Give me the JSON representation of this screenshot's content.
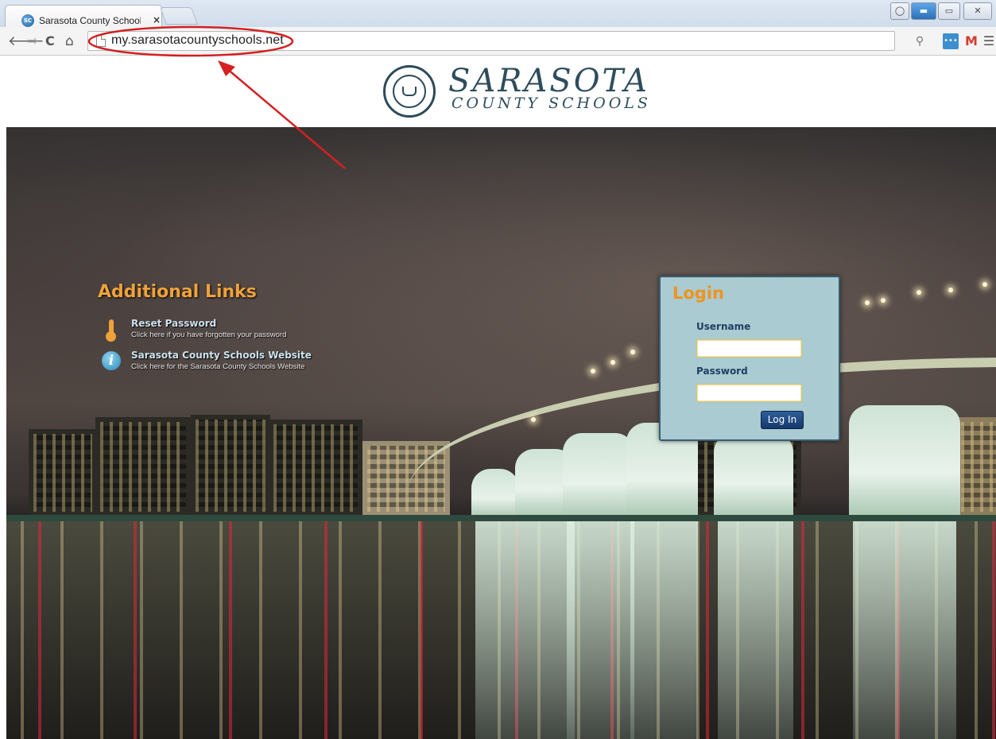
{
  "browser": {
    "tab_title": "Sarasota County Schools I",
    "tab_close": "×",
    "url": "my.sarasotacountyschools.net",
    "icons": [
      "back-icon",
      "forward-icon",
      "reload-icon",
      "home-icon",
      "page-icon",
      "key-icon",
      "lastpass-icon",
      "gmail-icon",
      "menu-icon"
    ]
  },
  "header": {
    "brand_line1": "SARASOTA",
    "brand_line2": "COUNTY SCHOOLS"
  },
  "additional_links": {
    "title": "Additional Links",
    "items": [
      {
        "title": "Reset Password",
        "subtitle": "Click here if you have forgotten your password",
        "icon": "thermometer-icon"
      },
      {
        "title": "Sarasota County Schools Website",
        "subtitle": "Click here for the Sarasota County Schools Website",
        "icon": "info-icon"
      }
    ]
  },
  "login": {
    "title": "Login",
    "username_label": "Username",
    "password_label": "Password",
    "username_value": "",
    "password_value": "",
    "button_label": "Log In"
  },
  "colors": {
    "accent_orange": "#f0a23a",
    "login_bg": "#a9cbd1",
    "button_blue": "#1f4a80",
    "annotation_red": "#d42020"
  }
}
